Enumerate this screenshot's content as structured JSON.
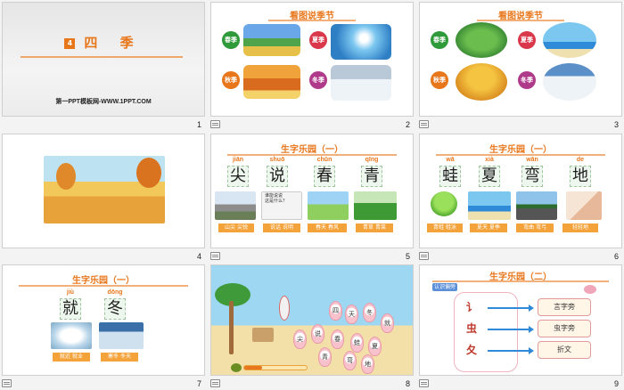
{
  "slides": [
    {
      "number": "1",
      "title_badge": "4",
      "title": "四 季",
      "footer": "第一PPT模板网-WWW.1PPT.COM"
    },
    {
      "number": "2",
      "heading": "看图说季节",
      "seasons": [
        "春季",
        "夏季",
        "秋季",
        "冬季"
      ]
    },
    {
      "number": "3",
      "heading": "看图说季节",
      "seasons": [
        "春季",
        "夏季",
        "秋季",
        "冬季"
      ]
    },
    {
      "number": "4"
    },
    {
      "number": "5",
      "heading": "生字乐园（一）",
      "chars": [
        {
          "pinyin": "jiān",
          "char": "尖"
        },
        {
          "pinyin": "shuō",
          "char": "说"
        },
        {
          "pinyin": "chūn",
          "char": "春"
        },
        {
          "pinyin": "qīng",
          "char": "青"
        }
      ],
      "words": [
        "山尖  尖锐",
        "说话  说明",
        "春天  春风",
        "青草  青菜"
      ],
      "bubble": "谁能说说\n这是什么？"
    },
    {
      "number": "6",
      "heading": "生字乐园（一）",
      "chars": [
        {
          "pinyin": "wā",
          "char": "蛙"
        },
        {
          "pinyin": "xià",
          "char": "夏"
        },
        {
          "pinyin": "wān",
          "char": "弯"
        },
        {
          "pinyin": "de",
          "char": "地"
        }
      ],
      "words": [
        "青蛙  蛙泳",
        "夏天  夏季",
        "弯曲  弯弓",
        "轻轻地"
      ]
    },
    {
      "number": "7",
      "heading": "生字乐园（一）",
      "chars": [
        {
          "pinyin": "jiù",
          "char": "就"
        },
        {
          "pinyin": "dōng",
          "char": "冬"
        }
      ],
      "words": [
        "就近  就业",
        "寒冬  冬天"
      ]
    },
    {
      "number": "8",
      "petals": [
        "四",
        "天",
        "冬",
        "尖",
        "就",
        "说",
        "青",
        "春",
        "蛙",
        "夏",
        "弯",
        "地"
      ]
    },
    {
      "number": "9",
      "heading": "生字乐园（二）",
      "tag": "认识偏旁",
      "radicals": [
        "讠",
        "虫",
        "夂"
      ],
      "names": [
        "言字旁",
        "虫字旁",
        "折文"
      ]
    }
  ],
  "colors": {
    "accent": "#e8771c",
    "line": "#f3b07a",
    "word_bar": "#f4a23a",
    "spring": "#2f9a3a",
    "summer": "#d9374a",
    "autumn": "#e8771c",
    "winter": "#b03a8a"
  }
}
